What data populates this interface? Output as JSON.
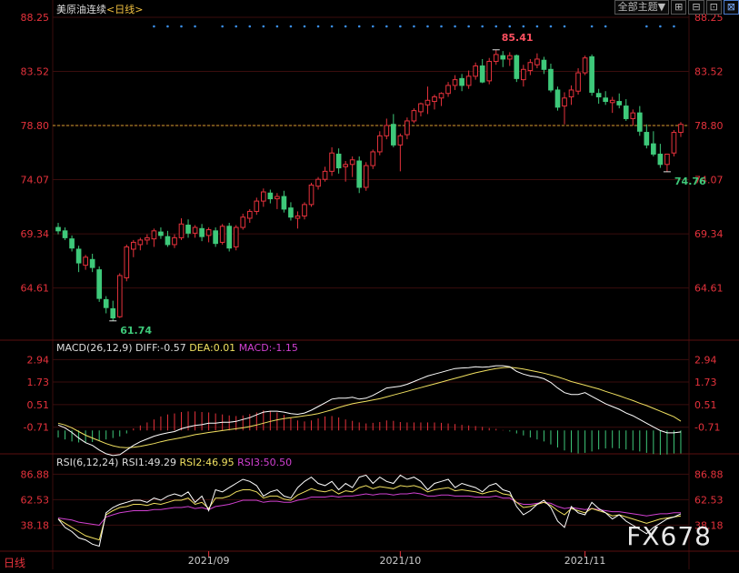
{
  "header": {
    "instrument": "美原油连续",
    "period_tag": "<日线>"
  },
  "toolbar": {
    "theme_label": "全部主题▼",
    "buttons": [
      "⊞",
      "⊟",
      "⊡",
      "⊠"
    ]
  },
  "colors": {
    "up": "#e6323c",
    "down": "#3ec97a",
    "diff": "#ffffff",
    "dea": "#f0e060",
    "rsi1": "#ffffff",
    "rsi2": "#f0e060",
    "rsi3": "#d040d0",
    "grid": "#3a0d0d",
    "axis": "#e6323c",
    "dots": "#3a8ee6"
  },
  "macd_header": {
    "name": "MACD(26,12,9)",
    "diff": "DIFF:-0.57",
    "dea": "DEA:0.01",
    "macd": "MACD:-1.15"
  },
  "rsi_header": {
    "name": "RSI(6,12,24)",
    "rsi1": "RSI1:49.29",
    "rsi2": "RSI2:46.95",
    "rsi3": "RSI3:50.50"
  },
  "period_label": "日线",
  "watermark": "FX678",
  "chart_data": {
    "type": "candlestick",
    "price_ticks": [
      "88.25",
      "83.52",
      "78.80",
      "74.07",
      "69.34",
      "64.61"
    ],
    "price_tick_values": [
      88.25,
      83.52,
      78.8,
      74.07,
      69.34,
      64.61
    ],
    "price_range": [
      59.5,
      88.25
    ],
    "current_price": 78.8,
    "high_label": "85.41",
    "low_label": "61.74",
    "recent_low_label": "74.76",
    "macd_ticks": [
      "2.94",
      "1.73",
      "0.51",
      "-0.71"
    ],
    "macd_tick_values": [
      2.94,
      1.73,
      0.51,
      -0.71
    ],
    "macd_range": [
      -2.0,
      3.4
    ],
    "rsi_ticks": [
      "86.88",
      "62.53",
      "38.18"
    ],
    "rsi_tick_values": [
      86.88,
      62.53,
      38.18
    ],
    "rsi_range": [
      15,
      95
    ],
    "x_labels": [
      {
        "label": "2021/09",
        "index": 22
      },
      {
        "label": "2021/10",
        "index": 50
      },
      {
        "label": "2021/11",
        "index": 77
      }
    ],
    "candles": [
      [
        69.9,
        70.3,
        69.3,
        69.6
      ],
      [
        69.6,
        69.9,
        68.8,
        69.0
      ],
      [
        68.9,
        69.2,
        67.8,
        68.1
      ],
      [
        68.0,
        68.3,
        66.0,
        66.8
      ],
      [
        66.6,
        67.5,
        66.2,
        67.3
      ],
      [
        67.1,
        67.6,
        66.0,
        66.4
      ],
      [
        66.2,
        66.5,
        63.4,
        63.7
      ],
      [
        63.6,
        63.9,
        62.4,
        62.9
      ],
      [
        62.8,
        63.5,
        61.74,
        62.0
      ],
      [
        62.1,
        65.9,
        62.0,
        65.7
      ],
      [
        65.5,
        68.4,
        65.2,
        68.2
      ],
      [
        68.0,
        68.8,
        67.3,
        68.6
      ],
      [
        68.4,
        69.0,
        67.9,
        68.8
      ],
      [
        68.8,
        69.3,
        68.4,
        69.0
      ],
      [
        68.9,
        69.8,
        68.2,
        69.6
      ],
      [
        69.5,
        69.9,
        68.9,
        69.2
      ],
      [
        69.1,
        69.6,
        68.2,
        68.4
      ],
      [
        68.4,
        69.3,
        68.1,
        69.0
      ],
      [
        69.0,
        70.7,
        68.8,
        70.2
      ],
      [
        70.1,
        70.6,
        69.0,
        69.4
      ],
      [
        69.4,
        70.1,
        69.0,
        69.9
      ],
      [
        69.8,
        70.2,
        68.7,
        69.1
      ],
      [
        69.2,
        69.9,
        68.6,
        69.7
      ],
      [
        69.6,
        69.9,
        68.2,
        68.5
      ],
      [
        68.6,
        70.2,
        68.4,
        70.0
      ],
      [
        70.0,
        70.3,
        67.8,
        68.1
      ],
      [
        68.2,
        70.1,
        67.9,
        69.9
      ],
      [
        69.9,
        71.1,
        69.7,
        70.8
      ],
      [
        70.7,
        71.5,
        70.3,
        71.3
      ],
      [
        71.3,
        72.5,
        71.0,
        72.2
      ],
      [
        72.2,
        73.3,
        71.7,
        73.0
      ],
      [
        72.9,
        73.2,
        72.0,
        72.4
      ],
      [
        72.4,
        72.9,
        71.5,
        72.6
      ],
      [
        72.6,
        73.1,
        71.2,
        71.5
      ],
      [
        71.6,
        72.1,
        70.5,
        70.8
      ],
      [
        70.7,
        71.3,
        69.8,
        70.9
      ],
      [
        70.9,
        72.1,
        70.6,
        71.9
      ],
      [
        71.9,
        73.8,
        71.7,
        73.6
      ],
      [
        73.5,
        74.3,
        73.2,
        74.1
      ],
      [
        74.1,
        75.2,
        73.9,
        74.8
      ],
      [
        74.8,
        76.9,
        74.4,
        76.4
      ],
      [
        76.3,
        76.8,
        74.6,
        75.1
      ],
      [
        75.2,
        75.7,
        73.9,
        75.4
      ],
      [
        75.4,
        76.1,
        74.3,
        75.8
      ],
      [
        75.7,
        76.1,
        72.9,
        73.4
      ],
      [
        73.4,
        75.6,
        73.1,
        75.3
      ],
      [
        75.3,
        76.7,
        75.0,
        76.5
      ],
      [
        76.5,
        78.3,
        76.2,
        77.9
      ],
      [
        77.9,
        79.4,
        77.6,
        78.8
      ],
      [
        78.9,
        79.8,
        76.9,
        77.1
      ],
      [
        77.1,
        78.1,
        74.8,
        77.9
      ],
      [
        78.0,
        79.5,
        77.6,
        79.2
      ],
      [
        79.2,
        80.3,
        79.0,
        80.1
      ],
      [
        80.0,
        80.8,
        79.6,
        80.7
      ],
      [
        80.6,
        82.2,
        79.8,
        81.0
      ],
      [
        80.9,
        81.5,
        80.2,
        81.3
      ],
      [
        81.2,
        81.7,
        80.5,
        81.6
      ],
      [
        81.6,
        82.6,
        81.3,
        82.3
      ],
      [
        82.3,
        83.2,
        81.9,
        82.8
      ],
      [
        82.9,
        83.3,
        81.8,
        82.3
      ],
      [
        82.3,
        83.6,
        82.0,
        83.1
      ],
      [
        83.1,
        84.3,
        82.8,
        84.0
      ],
      [
        84.0,
        84.6,
        82.5,
        82.6
      ],
      [
        82.7,
        84.7,
        82.4,
        84.4
      ],
      [
        84.4,
        85.41,
        84.1,
        85.0
      ],
      [
        84.9,
        85.3,
        83.9,
        84.6
      ],
      [
        84.6,
        85.2,
        84.0,
        84.9
      ],
      [
        84.9,
        85.0,
        82.6,
        82.9
      ],
      [
        82.8,
        84.1,
        82.2,
        83.7
      ],
      [
        83.6,
        84.6,
        83.2,
        84.3
      ],
      [
        84.1,
        85.1,
        83.8,
        84.6
      ],
      [
        84.5,
        84.8,
        83.3,
        83.7
      ],
      [
        83.7,
        84.2,
        81.7,
        81.9
      ],
      [
        81.9,
        82.2,
        80.1,
        80.4
      ],
      [
        80.5,
        81.7,
        78.9,
        81.2
      ],
      [
        81.3,
        82.3,
        80.6,
        81.9
      ],
      [
        81.8,
        83.8,
        81.5,
        83.4
      ],
      [
        83.4,
        84.9,
        83.2,
        84.7
      ],
      [
        84.8,
        85.0,
        81.4,
        81.7
      ],
      [
        81.6,
        82.0,
        80.7,
        81.3
      ],
      [
        81.2,
        81.8,
        80.6,
        80.9
      ],
      [
        80.8,
        81.3,
        79.9,
        81.0
      ],
      [
        80.9,
        81.6,
        80.3,
        80.6
      ],
      [
        80.5,
        81.1,
        79.2,
        79.4
      ],
      [
        79.4,
        80.2,
        78.8,
        79.9
      ],
      [
        79.9,
        80.5,
        77.9,
        78.3
      ],
      [
        78.2,
        78.9,
        76.8,
        77.1
      ],
      [
        77.2,
        78.3,
        76.1,
        76.3
      ],
      [
        76.3,
        77.2,
        75.1,
        75.4
      ],
      [
        75.4,
        76.0,
        74.76,
        76.3
      ],
      [
        76.4,
        78.4,
        76.1,
        78.2
      ],
      [
        78.2,
        79.1,
        77.8,
        78.9
      ]
    ],
    "macd": [
      {
        "diff": -0.2,
        "dea": -0.1,
        "hist": -0.35
      },
      {
        "diff": -0.35,
        "dea": -0.2,
        "hist": -0.45
      },
      {
        "diff": -0.6,
        "dea": -0.35,
        "hist": -0.55
      },
      {
        "diff": -0.9,
        "dea": -0.55,
        "hist": -0.6
      },
      {
        "diff": -1.15,
        "dea": -0.75,
        "hist": -0.62
      },
      {
        "diff": -1.3,
        "dea": -0.9,
        "hist": -0.58
      },
      {
        "diff": -1.55,
        "dea": -1.05,
        "hist": -0.5
      },
      {
        "diff": -1.75,
        "dea": -1.2,
        "hist": -0.45
      },
      {
        "diff": -1.85,
        "dea": -1.32,
        "hist": -0.38
      },
      {
        "diff": -1.8,
        "dea": -1.4,
        "hist": -0.3
      },
      {
        "diff": -1.55,
        "dea": -1.42,
        "hist": -0.15
      },
      {
        "diff": -1.3,
        "dea": -1.4,
        "hist": 0.1
      },
      {
        "diff": -1.1,
        "dea": -1.35,
        "hist": 0.25
      },
      {
        "diff": -0.95,
        "dea": -1.28,
        "hist": 0.4
      },
      {
        "diff": -0.8,
        "dea": -1.2,
        "hist": 0.55
      },
      {
        "diff": -0.7,
        "dea": -1.1,
        "hist": 0.7
      },
      {
        "diff": -0.62,
        "dea": -1.02,
        "hist": 0.8
      },
      {
        "diff": -0.55,
        "dea": -0.95,
        "hist": 0.85
      },
      {
        "diff": -0.4,
        "dea": -0.88,
        "hist": 0.92
      },
      {
        "diff": -0.3,
        "dea": -0.8,
        "hist": 0.95
      },
      {
        "diff": -0.22,
        "dea": -0.72,
        "hist": 0.95
      },
      {
        "diff": -0.18,
        "dea": -0.66,
        "hist": 0.92
      },
      {
        "diff": -0.1,
        "dea": -0.6,
        "hist": 0.9
      },
      {
        "diff": -0.1,
        "dea": -0.55,
        "hist": 0.85
      },
      {
        "diff": -0.05,
        "dea": -0.5,
        "hist": 0.8
      },
      {
        "diff": -0.05,
        "dea": -0.45,
        "hist": 0.75
      },
      {
        "diff": 0.0,
        "dea": -0.4,
        "hist": 0.72
      },
      {
        "diff": 0.1,
        "dea": -0.35,
        "hist": 0.75
      },
      {
        "diff": 0.2,
        "dea": -0.28,
        "hist": 0.82
      },
      {
        "diff": 0.35,
        "dea": -0.2,
        "hist": 0.9
      },
      {
        "diff": 0.5,
        "dea": -0.1,
        "hist": 1.0
      },
      {
        "diff": 0.55,
        "dea": 0.0,
        "hist": 0.98
      },
      {
        "diff": 0.55,
        "dea": 0.08,
        "hist": 0.9
      },
      {
        "diff": 0.5,
        "dea": 0.15,
        "hist": 0.78
      },
      {
        "diff": 0.42,
        "dea": 0.2,
        "hist": 0.62
      },
      {
        "diff": 0.38,
        "dea": 0.25,
        "hist": 0.5
      },
      {
        "diff": 0.45,
        "dea": 0.3,
        "hist": 0.45
      },
      {
        "diff": 0.6,
        "dea": 0.35,
        "hist": 0.5
      },
      {
        "diff": 0.8,
        "dea": 0.42,
        "hist": 0.6
      },
      {
        "diff": 1.0,
        "dea": 0.52,
        "hist": 0.7
      },
      {
        "diff": 1.2,
        "dea": 0.62,
        "hist": 0.72
      },
      {
        "diff": 1.25,
        "dea": 0.75,
        "hist": 0.65
      },
      {
        "diff": 1.25,
        "dea": 0.85,
        "hist": 0.55
      },
      {
        "diff": 1.3,
        "dea": 0.95,
        "hist": 0.48
      },
      {
        "diff": 1.2,
        "dea": 1.02,
        "hist": 0.4
      },
      {
        "diff": 1.25,
        "dea": 1.08,
        "hist": 0.35
      },
      {
        "diff": 1.4,
        "dea": 1.15,
        "hist": 0.38
      },
      {
        "diff": 1.6,
        "dea": 1.22,
        "hist": 0.42
      },
      {
        "diff": 1.8,
        "dea": 1.32,
        "hist": 0.5
      },
      {
        "diff": 1.85,
        "dea": 1.42,
        "hist": 0.48
      },
      {
        "diff": 1.9,
        "dea": 1.52,
        "hist": 0.42
      },
      {
        "diff": 2.0,
        "dea": 1.62,
        "hist": 0.4
      },
      {
        "diff": 2.15,
        "dea": 1.72,
        "hist": 0.4
      },
      {
        "diff": 2.3,
        "dea": 1.82,
        "hist": 0.4
      },
      {
        "diff": 2.45,
        "dea": 1.92,
        "hist": 0.4
      },
      {
        "diff": 2.55,
        "dea": 2.02,
        "hist": 0.4
      },
      {
        "diff": 2.65,
        "dea": 2.12,
        "hist": 0.38
      },
      {
        "diff": 2.75,
        "dea": 2.22,
        "hist": 0.35
      },
      {
        "diff": 2.85,
        "dea": 2.32,
        "hist": 0.32
      },
      {
        "diff": 2.88,
        "dea": 2.42,
        "hist": 0.28
      },
      {
        "diff": 2.9,
        "dea": 2.52,
        "hist": 0.25
      },
      {
        "diff": 2.95,
        "dea": 2.62,
        "hist": 0.22
      },
      {
        "diff": 2.92,
        "dea": 2.7,
        "hist": 0.18
      },
      {
        "diff": 2.95,
        "dea": 2.78,
        "hist": 0.12
      },
      {
        "diff": 3.0,
        "dea": 2.85,
        "hist": 0.08
      },
      {
        "diff": 3.0,
        "dea": 2.9,
        "hist": 0.02
      },
      {
        "diff": 2.95,
        "dea": 2.92,
        "hist": -0.05
      },
      {
        "diff": 2.7,
        "dea": 2.88,
        "hist": -0.15
      },
      {
        "diff": 2.55,
        "dea": 2.82,
        "hist": -0.25
      },
      {
        "diff": 2.45,
        "dea": 2.75,
        "hist": -0.35
      },
      {
        "diff": 2.4,
        "dea": 2.68,
        "hist": -0.45
      },
      {
        "diff": 2.3,
        "dea": 2.6,
        "hist": -0.55
      },
      {
        "diff": 2.1,
        "dea": 2.5,
        "hist": -0.7
      },
      {
        "diff": 1.8,
        "dea": 2.4,
        "hist": -0.85
      },
      {
        "diff": 1.55,
        "dea": 2.28,
        "hist": -1.0
      },
      {
        "diff": 1.45,
        "dea": 2.15,
        "hist": -1.1
      },
      {
        "diff": 1.45,
        "dea": 2.05,
        "hist": -1.15
      },
      {
        "diff": 1.55,
        "dea": 1.95,
        "hist": -1.12
      },
      {
        "diff": 1.35,
        "dea": 1.85,
        "hist": -1.05
      },
      {
        "diff": 1.15,
        "dea": 1.75,
        "hist": -0.95
      },
      {
        "diff": 0.95,
        "dea": 1.62,
        "hist": -0.9
      },
      {
        "diff": 0.8,
        "dea": 1.5,
        "hist": -0.88
      },
      {
        "diff": 0.65,
        "dea": 1.38,
        "hist": -0.9
      },
      {
        "diff": 0.45,
        "dea": 1.25,
        "hist": -0.95
      },
      {
        "diff": 0.3,
        "dea": 1.12,
        "hist": -1.0
      },
      {
        "diff": 0.1,
        "dea": 0.98,
        "hist": -1.05
      },
      {
        "diff": -0.1,
        "dea": 0.85,
        "hist": -1.12
      },
      {
        "diff": -0.3,
        "dea": 0.7,
        "hist": -1.18
      },
      {
        "diff": -0.5,
        "dea": 0.55,
        "hist": -1.22
      },
      {
        "diff": -0.62,
        "dea": 0.4,
        "hist": -1.2
      },
      {
        "diff": -0.62,
        "dea": 0.25,
        "hist": -1.15
      },
      {
        "diff": -0.57,
        "dea": 0.01,
        "hist": -1.15
      }
    ],
    "rsi": {
      "rsi1": [
        44,
        36,
        32,
        26,
        24,
        20,
        18,
        50,
        55,
        58,
        60,
        62,
        62,
        60,
        64,
        62,
        66,
        68,
        66,
        70,
        60,
        66,
        52,
        72,
        70,
        74,
        78,
        82,
        80,
        76,
        66,
        70,
        72,
        66,
        64,
        74,
        80,
        84,
        78,
        76,
        80,
        72,
        78,
        74,
        84,
        86,
        78,
        84,
        80,
        78,
        86,
        82,
        84,
        80,
        72,
        78,
        80,
        82,
        74,
        78,
        76,
        74,
        70,
        76,
        78,
        72,
        70,
        56,
        48,
        52,
        58,
        62,
        55,
        42,
        36,
        56,
        50,
        48,
        60,
        54,
        50,
        44,
        48,
        42,
        38,
        34,
        30,
        36,
        40,
        44,
        46,
        49
      ],
      "rsi2": [
        44,
        40,
        36,
        32,
        28,
        26,
        24,
        48,
        52,
        55,
        56,
        58,
        58,
        57,
        59,
        58,
        60,
        62,
        62,
        64,
        58,
        60,
        54,
        64,
        64,
        66,
        70,
        72,
        72,
        70,
        64,
        66,
        66,
        63,
        62,
        67,
        70,
        73,
        71,
        70,
        72,
        68,
        71,
        70,
        74,
        76,
        73,
        75,
        74,
        73,
        76,
        75,
        76,
        74,
        70,
        72,
        73,
        74,
        71,
        72,
        71,
        70,
        68,
        70,
        71,
        68,
        67,
        60,
        55,
        56,
        58,
        60,
        57,
        52,
        48,
        54,
        52,
        50,
        54,
        52,
        50,
        47,
        48,
        46,
        44,
        42,
        40,
        42,
        44,
        45,
        46,
        47
      ],
      "rsi3": [
        45,
        44,
        43,
        41,
        40,
        39,
        38,
        46,
        48,
        50,
        51,
        52,
        52,
        52,
        53,
        53,
        54,
        55,
        55,
        56,
        54,
        55,
        53,
        56,
        57,
        58,
        60,
        62,
        62,
        62,
        60,
        61,
        61,
        60,
        60,
        62,
        63,
        65,
        65,
        65,
        66,
        65,
        66,
        66,
        67,
        68,
        67,
        68,
        68,
        67,
        68,
        68,
        69,
        68,
        66,
        66,
        67,
        67,
        66,
        66,
        66,
        65,
        65,
        65,
        66,
        64,
        64,
        60,
        58,
        58,
        59,
        60,
        59,
        56,
        54,
        55,
        54,
        53,
        54,
        53,
        52,
        51,
        51,
        50,
        49,
        48,
        47,
        48,
        49,
        49,
        50,
        50
      ]
    }
  }
}
